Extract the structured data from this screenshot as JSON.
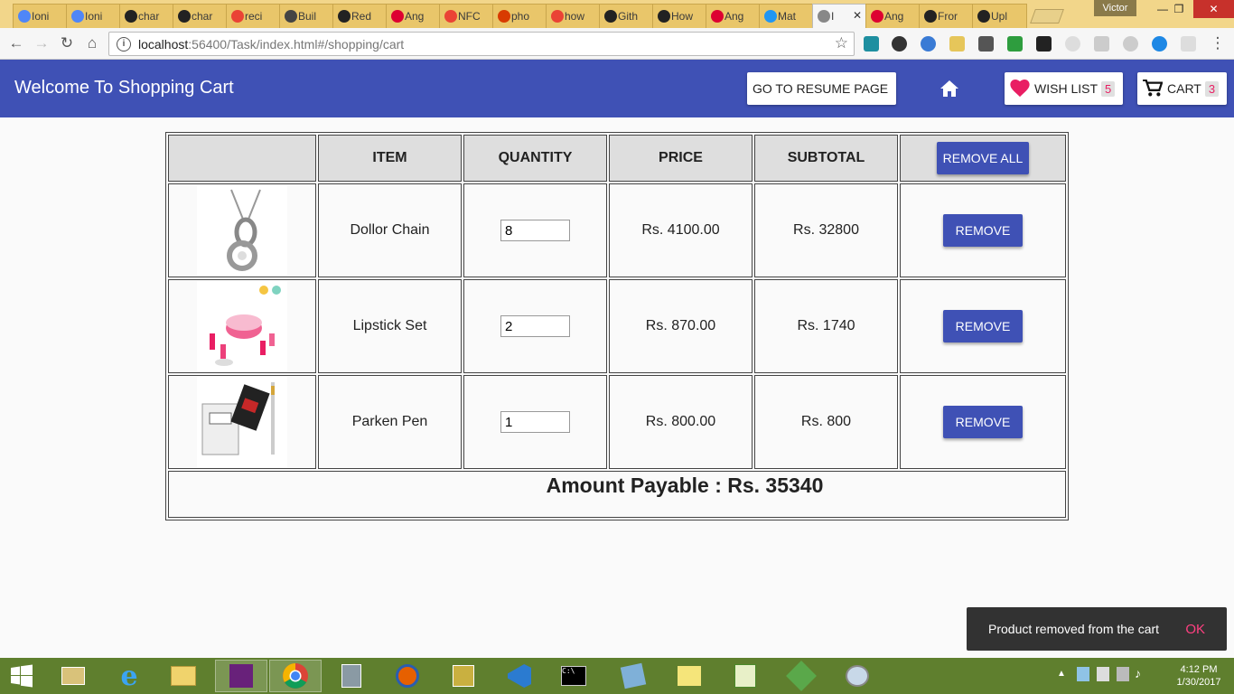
{
  "browser": {
    "tabs": [
      {
        "label": "Ioni",
        "icon": "ionic-icon",
        "color": "#4f86f7"
      },
      {
        "label": "Ioni",
        "icon": "ionic-icon",
        "color": "#4f86f7"
      },
      {
        "label": "char",
        "icon": "github-icon",
        "color": "#222222"
      },
      {
        "label": "char",
        "icon": "github-icon",
        "color": "#222222"
      },
      {
        "label": "reci",
        "icon": "google-icon",
        "color": "#ea4335"
      },
      {
        "label": "Buil",
        "icon": "office-icon",
        "color": "#444444"
      },
      {
        "label": "Red",
        "icon": "github-icon",
        "color": "#222222"
      },
      {
        "label": "Ang",
        "icon": "angular-icon",
        "color": "#dd0031"
      },
      {
        "label": "NFC",
        "icon": "google-icon",
        "color": "#ea4335"
      },
      {
        "label": "pho",
        "icon": "office-icon",
        "color": "#d83b01"
      },
      {
        "label": "how",
        "icon": "google-icon",
        "color": "#ea4335"
      },
      {
        "label": "Gith",
        "icon": "github-icon",
        "color": "#222222"
      },
      {
        "label": "How",
        "icon": "github-icon",
        "color": "#222222"
      },
      {
        "label": "Ang",
        "icon": "angular-icon",
        "color": "#dd0031"
      },
      {
        "label": "Mat",
        "icon": "material-icon",
        "color": "#2196f3"
      },
      {
        "label": "I",
        "icon": "page-icon",
        "color": "#888888"
      },
      {
        "label": "Ang",
        "icon": "angular-icon",
        "color": "#dd0031"
      },
      {
        "label": "Fror",
        "icon": "github-icon",
        "color": "#222222"
      },
      {
        "label": "Upl",
        "icon": "github-icon",
        "color": "#222222"
      }
    ],
    "user": "Victor",
    "url_host": "localhost",
    "url_rest": ":56400/Task/index.html#/shopping/cart"
  },
  "app": {
    "title": "Welcome To Shopping Cart",
    "resume_label": "GO TO RESUME PAGE",
    "wishlist_label": "WISH LIST",
    "wishlist_count": "5",
    "cart_label": "CART",
    "cart_count": "3",
    "accent": "#3f51b5",
    "pink": "#e91e63"
  },
  "cart": {
    "headers": {
      "image": "",
      "item": "ITEM",
      "quantity": "QUANTITY",
      "price": "PRICE",
      "subtotal": "SUBTOTAL",
      "remove_all": "REMOVE ALL"
    },
    "rows": [
      {
        "item": "Dollor Chain",
        "quantity": "8",
        "price": "Rs. 4100.00",
        "subtotal": "Rs. 32800",
        "remove": "REMOVE"
      },
      {
        "item": "Lipstick Set",
        "quantity": "2",
        "price": "Rs. 870.00",
        "subtotal": "Rs. 1740",
        "remove": "REMOVE"
      },
      {
        "item": "Parken Pen",
        "quantity": "1",
        "price": "Rs. 800.00",
        "subtotal": "Rs. 800",
        "remove": "REMOVE"
      }
    ],
    "amount": "Amount Payable : Rs. 35340"
  },
  "snackbar": {
    "message": "Product removed from the cart",
    "action": "OK"
  },
  "taskbar": {
    "time": "4:12 PM",
    "date": "1/30/2017"
  }
}
